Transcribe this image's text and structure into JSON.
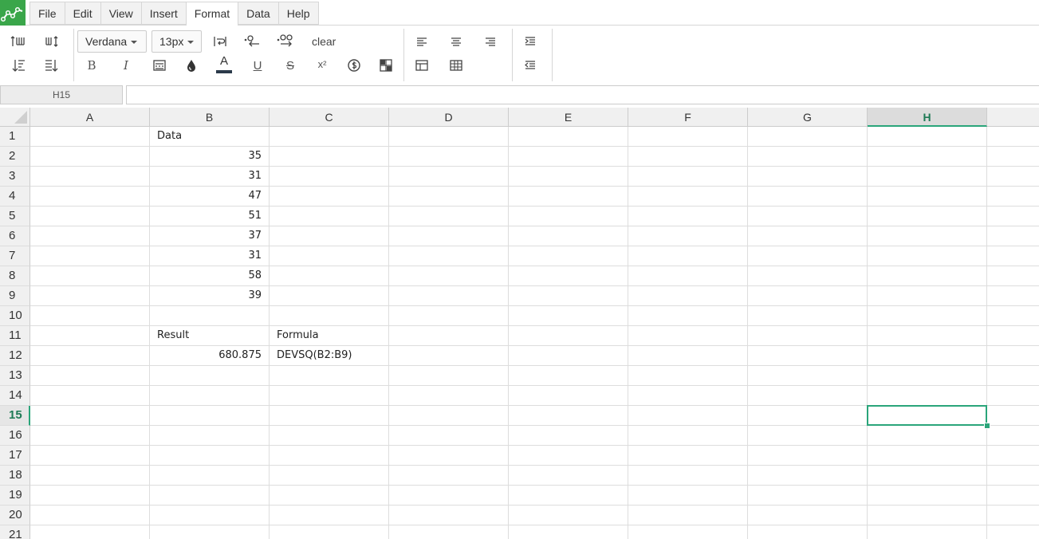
{
  "app": {
    "accent": "#2aa57a",
    "logo_color": "#3aa64a"
  },
  "menu": [
    "File",
    "Edit",
    "View",
    "Insert",
    "Format",
    "Data",
    "Help"
  ],
  "menu_active": "Format",
  "toolbar": {
    "font_family": "Verdana",
    "font_size": "13px",
    "clear_label": "clear",
    "icons_row1": [
      "column-width-icon",
      "row-height-icon",
      "wrap-text-icon",
      "decrease-decimals-icon",
      "increase-decimals-icon"
    ],
    "icons_row2": [
      "sort-asc-icon",
      "sort-desc-icon",
      "bold-icon",
      "italic-icon",
      "number-format-icon",
      "fill-color-icon",
      "text-color-icon",
      "underline-icon",
      "strikethrough-icon",
      "superscript-icon",
      "currency-icon",
      "merge-cells-icon",
      "borders-icon",
      "grid-borders-icon"
    ],
    "align_icons": [
      "align-left-icon",
      "align-center-icon",
      "align-right-icon"
    ],
    "indent_icons": [
      "indent-increase-icon",
      "indent-decrease-icon"
    ],
    "bold": "B",
    "italic": "I",
    "text_color_letter": "A",
    "underline": "U",
    "strike": "S",
    "superscript": "x²"
  },
  "formula_bar": {
    "cell_ref": "H15",
    "value": ""
  },
  "sheet": {
    "columns": [
      "A",
      "B",
      "C",
      "D",
      "E",
      "F",
      "G",
      "H"
    ],
    "active_column": "H",
    "rows": [
      "1",
      "2",
      "3",
      "4",
      "5",
      "6",
      "7",
      "8",
      "9",
      "10",
      "11",
      "12",
      "13",
      "14",
      "15",
      "16",
      "17",
      "18",
      "19",
      "20",
      "21"
    ],
    "active_row": "15",
    "cells": {
      "B1": "Data",
      "B2": "35",
      "B3": "31",
      "B4": "47",
      "B5": "51",
      "B6": "37",
      "B7": "31",
      "B8": "58",
      "B9": "39",
      "B11": "Result",
      "C11": "Formula",
      "B12": "680.875",
      "C12": "DEVSQ(B2:B9)"
    },
    "numeric_cells": [
      "B2",
      "B3",
      "B4",
      "B5",
      "B6",
      "B7",
      "B8",
      "B9",
      "B12"
    ],
    "selected_cell": "H15"
  }
}
